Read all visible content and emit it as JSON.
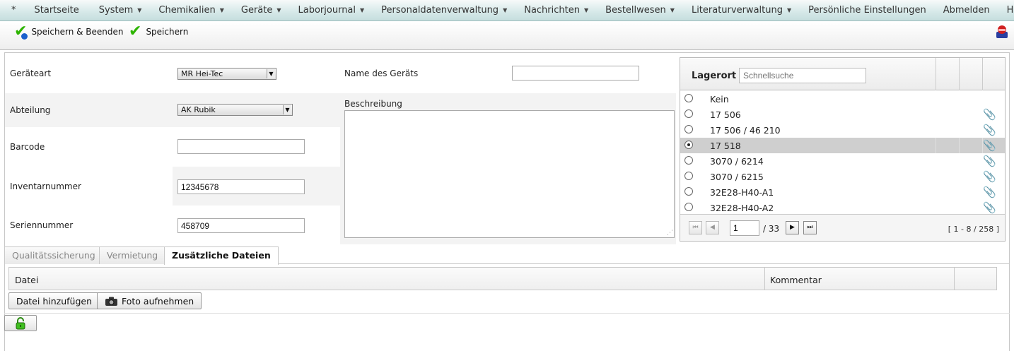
{
  "menu": {
    "star": "*",
    "items": [
      {
        "label": "Startseite",
        "caret": false
      },
      {
        "label": "System",
        "caret": true
      },
      {
        "label": "Chemikalien",
        "caret": true
      },
      {
        "label": "Geräte",
        "caret": true
      },
      {
        "label": "Laborjournal",
        "caret": true
      },
      {
        "label": "Personaldatenverwaltung",
        "caret": true
      },
      {
        "label": "Nachrichten",
        "caret": true
      },
      {
        "label": "Bestellwesen",
        "caret": true
      },
      {
        "label": "Literaturverwaltung",
        "caret": true
      },
      {
        "label": "Persönliche Einstellungen",
        "caret": false
      },
      {
        "label": "Abmelden",
        "caret": false
      },
      {
        "label": "Hilfe",
        "caret": false
      }
    ]
  },
  "toolbar": {
    "save_close_label": "Speichern & Beenden",
    "save_label": "Speichern",
    "check_glyph": "✔"
  },
  "form": {
    "device_type": {
      "label": "Geräteart",
      "value": "MR Hei-Tec"
    },
    "department": {
      "label": "Abteilung",
      "value": "AK Rubik"
    },
    "barcode": {
      "label": "Barcode",
      "value": ""
    },
    "inventory": {
      "label": "Inventarnummer",
      "value": "12345678"
    },
    "serial": {
      "label": "Seriennummer",
      "value": "458709"
    },
    "device_name": {
      "label": "Name des Geräts",
      "value": ""
    },
    "description": {
      "label": "Beschreibung",
      "value": ""
    }
  },
  "storage": {
    "title": "Lagerort",
    "search_placeholder": "Schnellsuche",
    "rows": [
      {
        "label": "Kein",
        "selected": false,
        "attachment": false
      },
      {
        "label": "17 506",
        "selected": false,
        "attachment": true
      },
      {
        "label": "17 506 / 46 210",
        "selected": false,
        "attachment": true
      },
      {
        "label": "17 518",
        "selected": true,
        "attachment": true
      },
      {
        "label": "3070 / 6214",
        "selected": false,
        "attachment": true
      },
      {
        "label": "3070 / 6215",
        "selected": false,
        "attachment": true
      },
      {
        "label": "32E28-H40-A1",
        "selected": false,
        "attachment": true
      },
      {
        "label": "32E28-H40-A2",
        "selected": false,
        "attachment": true
      }
    ],
    "pager": {
      "page": "1",
      "total": "/ 33",
      "range": "[ 1 - 8 / 258 ]"
    }
  },
  "tabs": [
    {
      "label": "Qualitätssicherung",
      "active": false
    },
    {
      "label": "Vermietung",
      "active": false
    },
    {
      "label": "Zusätzliche Dateien",
      "active": true
    }
  ],
  "files": {
    "col_file": "Datei",
    "col_comment": "Kommentar",
    "add_file_label": "Datei hinzufügen",
    "take_photo_label": "Foto aufnehmen"
  },
  "icons": {
    "clip": "📎",
    "camera": "📷"
  },
  "colors": {
    "menu_bg": "#d5e8e8",
    "check_green": "#2db400",
    "selected_row": "#cfcfcf"
  }
}
